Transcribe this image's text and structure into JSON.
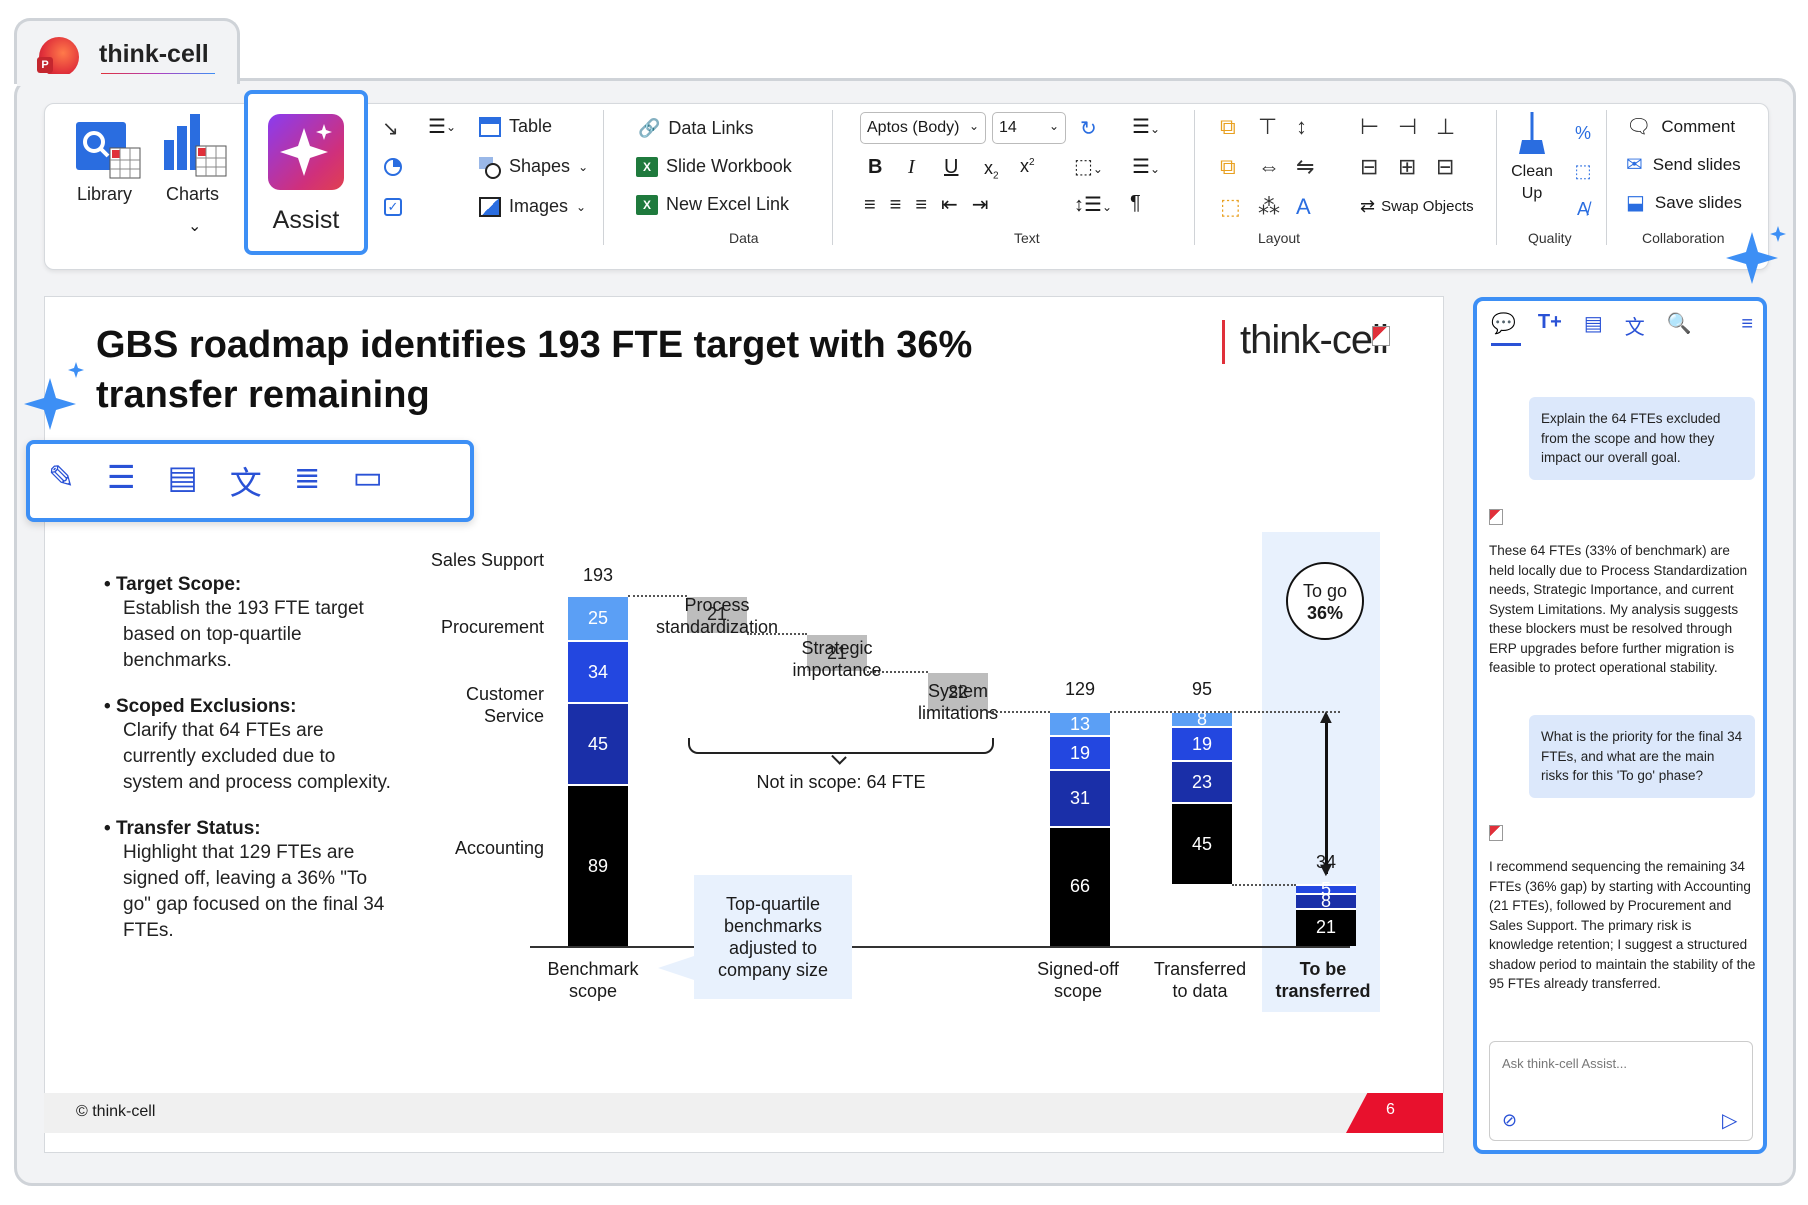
{
  "app": {
    "tab_title": "think-cell"
  },
  "ribbon": {
    "library": "Library",
    "charts": "Charts",
    "assist": "Assist",
    "table": "Table",
    "shapes": "Shapes",
    "images": "Images",
    "data_links": "Data Links",
    "slide_workbook": "Slide Workbook",
    "new_excel_link": "New Excel Link",
    "group_data": "Data",
    "font_name": "Aptos (Body)",
    "font_size": "14",
    "group_text": "Text",
    "swap_objects": "Swap Objects",
    "group_layout": "Layout",
    "clean_up": "Clean Up",
    "group_quality": "Quality",
    "comment": "Comment",
    "send_slides": "Send slides",
    "save_slides": "Save slides",
    "group_collaboration": "Collaboration"
  },
  "slide": {
    "title_line1": "GBS roadmap identifies 193 FTE target with 36%",
    "title_line2": "transfer remaining",
    "logo": "think-cell",
    "bullets": [
      {
        "heading": "Target Scope:",
        "text": "Establish the 193 FTE target based on top-quartile benchmarks."
      },
      {
        "heading": "Scoped Exclusions:",
        "text": "Clarify that 64 FTEs are currently excluded due to system and process complexity."
      },
      {
        "heading": "Transfer Status:",
        "text": "Highlight that 129 FTEs are signed off, leaving a 36% \"To go\" gap focused on the final 34 FTEs."
      }
    ],
    "footer": "© think-cell",
    "page_number": "6"
  },
  "chart_data": {
    "type": "bar",
    "subtype": "waterfall",
    "categories": [
      "Benchmark scope",
      "Process standardization",
      "Strategic importance",
      "System limitations",
      "Signed-off scope",
      "Transferred to data",
      "To be transferred"
    ],
    "segment_labels": [
      "Accounting",
      "Customer Service",
      "Procurement",
      "Sales Support"
    ],
    "stacks": {
      "benchmark": {
        "total": 193,
        "segments": [
          89,
          45,
          34,
          25
        ]
      },
      "process_standardization": 21,
      "strategic_importance": 21,
      "system_limitations": 22,
      "signed_off": {
        "total": 129,
        "segments": [
          66,
          31,
          19,
          13
        ]
      },
      "transferred": {
        "total": 95,
        "segments": [
          45,
          23,
          19,
          8
        ]
      },
      "to_be_transferred": {
        "total": 34,
        "segments": [
          21,
          8,
          5
        ]
      }
    },
    "annotations": {
      "not_in_scope": "Not in scope: 64 FTE",
      "callout": "Top-quartile benchmarks adjusted to company size",
      "togo_line1": "To go",
      "togo_line2": "36%"
    },
    "label_texts": {
      "sales_support": "Sales Support",
      "procurement": "Procurement",
      "customer_service_1": "Customer",
      "customer_service_2": "Service",
      "accounting": "Accounting",
      "process_1": "Process",
      "process_2": "standardization",
      "strategic_1": "Strategic",
      "strategic_2": "importance",
      "system_1": "System",
      "system_2": "limitations",
      "benchmark_1": "Benchmark",
      "benchmark_2": "scope",
      "signed_1": "Signed-off",
      "signed_2": "scope",
      "transferred_1": "Transferred",
      "transferred_2": "to data",
      "tobe_1": "To be",
      "tobe_2": "transferred",
      "callout_1": "Top-quartile",
      "callout_2": "benchmarks",
      "callout_3": "adjusted to",
      "callout_4": "company size"
    },
    "colors": {
      "accounting": "#000000",
      "customer_service": "#1a2fa8",
      "procurement": "#2347e0",
      "sales_support": "#5b9ff5",
      "excluded": "#bdbdbd",
      "highlight": "#e8f1fd"
    }
  },
  "assist_panel": {
    "messages": [
      {
        "role": "user",
        "text": "Explain the 64 FTEs excluded from the scope and how they impact our overall goal."
      },
      {
        "role": "assistant",
        "text": "These 64 FTEs (33% of benchmark) are held locally due to Process Standardization needs, Strategic Importance, and current System Limitations. My analysis suggests these blockers must be resolved through ERP upgrades before further migration is feasible to protect operational stability."
      },
      {
        "role": "user",
        "text": "What is the priority for the final 34 FTEs, and what are the main risks for this 'To go' phase?"
      },
      {
        "role": "assistant",
        "text": "I recommend sequencing the remaining 34 FTEs (36% gap) by starting with Accounting (21 FTEs), followed by Procurement and Sales Support. The primary risk is knowledge retention; I suggest a structured shadow period to maintain the stability of the 95 FTEs already transferred."
      }
    ],
    "input_placeholder": "Ask think-cell Assist..."
  }
}
